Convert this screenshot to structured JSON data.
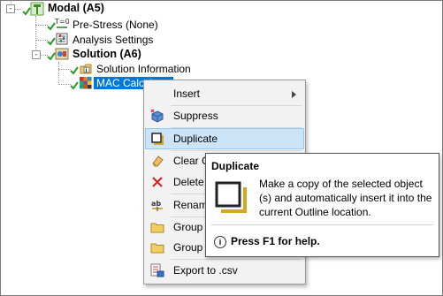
{
  "tree": {
    "modal": {
      "label": "Modal (A5)",
      "expander": "-"
    },
    "prestress": {
      "label": "Pre-Stress (None)"
    },
    "analysis_settings": {
      "label": "Analysis Settings"
    },
    "solution": {
      "label": "Solution (A6)",
      "expander": "-"
    },
    "solution_information": {
      "label": "Solution Information"
    },
    "mac_calculator": {
      "label": "MAC Calculator"
    }
  },
  "context_menu": {
    "items": [
      {
        "label": "Insert",
        "icon": "none",
        "submenu": true
      },
      {
        "label": "Suppress",
        "icon": "suppress-icon"
      },
      {
        "label": "Duplicate",
        "icon": "duplicate-icon",
        "highlighted": true
      },
      {
        "label": "Clear G",
        "icon": "eraser-icon"
      },
      {
        "label": "Delete",
        "icon": "delete-icon"
      },
      {
        "label": "Renam",
        "icon": "rename-icon"
      },
      {
        "label": "Group",
        "icon": "folder-icon"
      },
      {
        "label": "Group",
        "icon": "folder-icon"
      },
      {
        "label": "Export to .csv",
        "icon": "export-csv-icon"
      }
    ]
  },
  "tooltip": {
    "title": "Duplicate",
    "body": "Make a copy of the selected object (s) and automatically insert it into the current Outline location.",
    "help_icon": "i",
    "help": "Press F1 for help."
  },
  "colors": {
    "selection": "#0078d7",
    "menu_highlight": "#cce4f7",
    "check_green": "#2a9a2a"
  }
}
